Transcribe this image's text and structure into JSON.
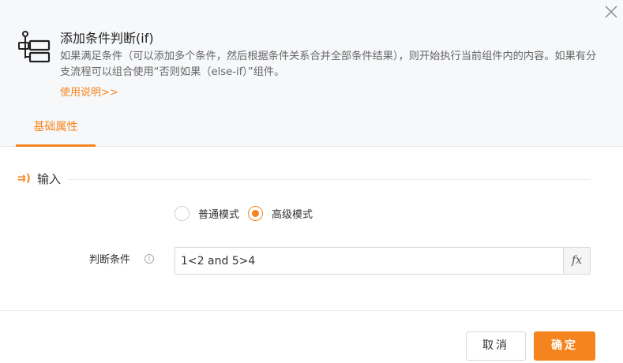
{
  "header": {
    "title": "添加条件判断(if)",
    "description": "如果满足条件（可以添加多个条件，然后根据条件关系合并全部条件结果），则开始执行当前组件内的内容。如果有分支流程可以组合使用“否则如果（else-if）”组件。",
    "usage_link": "使用说明>>"
  },
  "tabs": [
    {
      "label": "基础属性",
      "active": true
    }
  ],
  "section": {
    "icon": "⇉)",
    "title": "输入"
  },
  "mode": {
    "options": [
      {
        "label": "普通模式",
        "checked": false
      },
      {
        "label": "高级模式",
        "checked": true
      }
    ]
  },
  "condition": {
    "label": "判断条件",
    "value": "1<2 and 5>4",
    "fx_label": "fx"
  },
  "footer": {
    "cancel_label": "取消",
    "ok_label": "确定"
  },
  "colors": {
    "accent": "#f5841f",
    "header_bg": "#f7f8fa"
  }
}
